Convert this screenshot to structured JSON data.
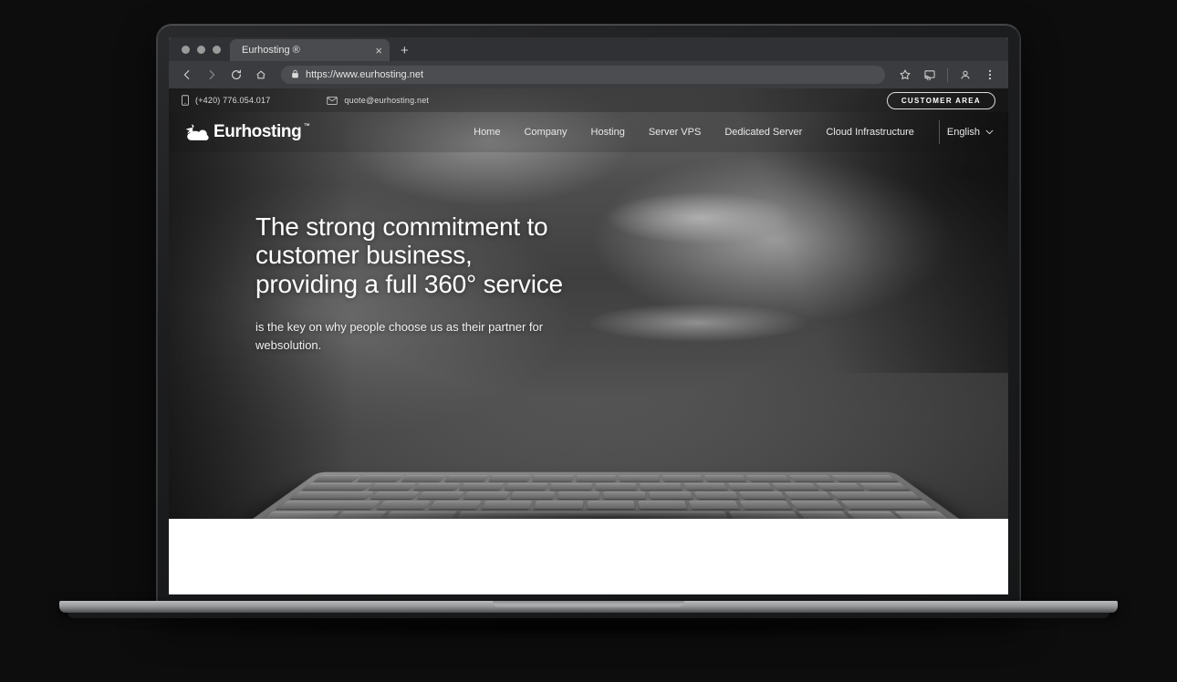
{
  "browser": {
    "window_dots": [
      "close",
      "minimize",
      "maximize"
    ],
    "tab_title": "Eurhosting ®",
    "tab_close_glyph": "×",
    "new_tab_glyph": "+",
    "url": "https://www.eurhosting.net",
    "nav_icons": [
      "back-arrow-icon",
      "forward-arrow-icon",
      "reload-icon",
      "home-icon"
    ],
    "omnibox_lock_icon": "lock-icon",
    "toolbar_right_icons": [
      "star-bookmark-icon",
      "cast-icon",
      "profile-icon",
      "kebab-menu-icon"
    ]
  },
  "site": {
    "topbar": {
      "phone": "(+420) 776.054.017",
      "phone_icon": "mobile-phone-icon",
      "email": "quote@eurhosting.net",
      "email_icon": "envelope-icon",
      "customer_area_label": "CUSTOMER AREA"
    },
    "logo": {
      "text": "Eurhosting",
      "trademark": "™",
      "mark": "bird-in-cloud-icon"
    },
    "nav": [
      {
        "label": "Home"
      },
      {
        "label": "Company"
      },
      {
        "label": "Hosting"
      },
      {
        "label": "Server VPS"
      },
      {
        "label": "Dedicated Server"
      },
      {
        "label": "Cloud Infrastructure"
      }
    ],
    "language": {
      "selected": "English",
      "chevron": "⌄"
    },
    "hero": {
      "heading_line1": "The strong commitment to",
      "heading_line2": "customer business,",
      "heading_line3": "providing a full 360° service",
      "subtext": "is the key on why people choose us as their partner for websolution.",
      "background": "blurred-grayscale-desk-with-keyboard-photo"
    }
  },
  "colors": {
    "page_background": "#0d0d0d",
    "browser_chrome": "#3b3c3f",
    "tabstrip": "#303134",
    "hero_text": "#ffffff",
    "white_section": "#ffffff",
    "laptop_base": "#b9bbbd"
  }
}
